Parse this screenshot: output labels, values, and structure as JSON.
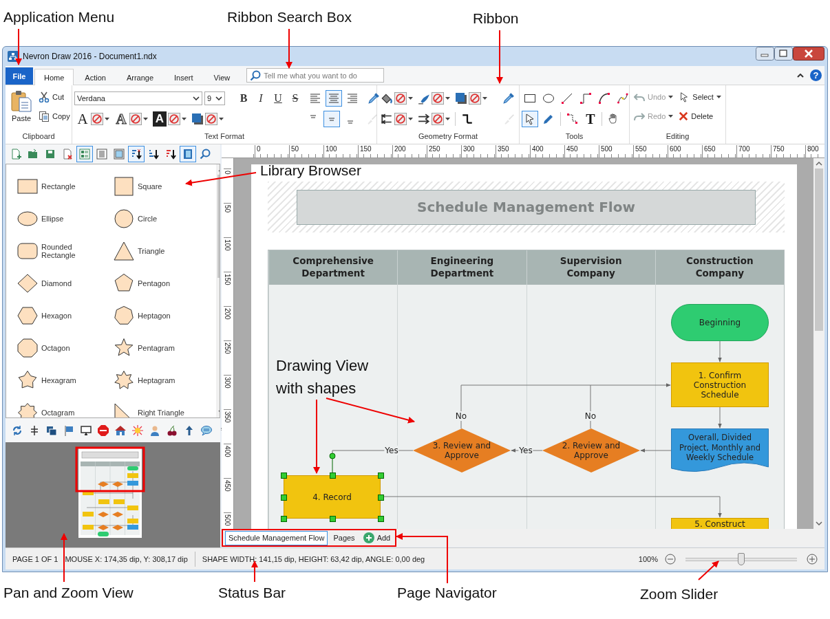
{
  "annotations": [
    {
      "text": "Application Menu"
    },
    {
      "text": "Ribbon Search Box"
    },
    {
      "text": "Ribbon"
    },
    {
      "text": "Library Browser"
    },
    {
      "text": "Drawing View with shapes"
    },
    {
      "text": "Pan and Zoom View"
    },
    {
      "text": "Status Bar"
    },
    {
      "text": "Page Navigator"
    },
    {
      "text": "Zoom Slider"
    }
  ],
  "window": {
    "title": "Nevron Draw 2016 - Document1.ndx"
  },
  "ribbon_tabs": {
    "file": "File",
    "tabs": [
      {
        "label": "Home",
        "selected": true
      },
      {
        "label": "Action",
        "selected": false
      },
      {
        "label": "Arrange",
        "selected": false
      },
      {
        "label": "Insert",
        "selected": false
      },
      {
        "label": "View",
        "selected": false
      }
    ],
    "search": {
      "placeholder": "Tell me what you want to do"
    },
    "help": "?"
  },
  "ribbon": {
    "clipboard": {
      "label": "Clipboard",
      "paste": "Paste",
      "cut": "Cut",
      "copy": "Copy"
    },
    "text_format": {
      "label": "Text Format",
      "font": "Verdana",
      "size": "9",
      "style_buttons": [
        {
          "glyph": "B",
          "kind": "bold"
        },
        {
          "glyph": "I",
          "kind": "italic"
        },
        {
          "glyph": "U",
          "kind": "underline"
        },
        {
          "glyph": "S",
          "kind": "strikethrough"
        }
      ],
      "horizontal_align": [
        {
          "selected": false
        },
        {
          "selected": true
        },
        {
          "selected": false
        }
      ],
      "color_buttons": [
        {
          "glyph": "A",
          "kind": "font_color"
        },
        {
          "glyph": "A",
          "kind": "outline"
        },
        {
          "glyph": "A",
          "kind": "highlight"
        }
      ],
      "vertical_align": [
        {
          "selected": false
        },
        {
          "selected": true
        },
        {
          "selected": false
        }
      ],
      "format_painter": {
        "disabled": true
      }
    },
    "geometry_format": {
      "label": "Geometry Format",
      "format_painter": {
        "disabled": true
      }
    },
    "tools": {
      "label": "Tools",
      "text_tool": "T",
      "pointer_tool": {
        "selected": true
      },
      "pen_tool": {
        "selected": false
      }
    },
    "editing": {
      "label": "Editing",
      "undo": {
        "label": "Undo",
        "disabled": true
      },
      "redo": {
        "label": "Redo",
        "disabled": true
      },
      "select": {
        "label": "Select"
      },
      "delete": {
        "label": "Delete"
      }
    }
  },
  "library": {
    "toolbar": {
      "view_modes": [
        {
          "selected": true
        },
        {
          "selected": false
        },
        {
          "selected": false
        }
      ],
      "sort_modes": [
        {
          "selected": true
        },
        {
          "selected": false
        },
        {
          "selected": false
        }
      ],
      "book": {
        "selected": true
      }
    },
    "items": [
      {
        "label": "Rectangle",
        "kind": "rectangle"
      },
      {
        "label": "Square",
        "kind": "square"
      },
      {
        "label": "Ellipse",
        "kind": "ellipse"
      },
      {
        "label": "Circle",
        "kind": "circle"
      },
      {
        "label": "Rounded Rectangle",
        "kind": "rounded_rectangle"
      },
      {
        "label": "Triangle",
        "kind": "triangle"
      },
      {
        "label": "Diamond",
        "kind": "diamond"
      },
      {
        "label": "Pentagon",
        "kind": "pentagon"
      },
      {
        "label": "Hexagon",
        "kind": "hexagon"
      },
      {
        "label": "Heptagon",
        "kind": "heptagon"
      },
      {
        "label": "Octagon",
        "kind": "octagon"
      },
      {
        "label": "Pentagram",
        "kind": "pentagram"
      },
      {
        "label": "Hexagram",
        "kind": "hexagram"
      },
      {
        "label": "Heptagram",
        "kind": "heptagram"
      },
      {
        "label": "Octagram",
        "kind": "octagram"
      },
      {
        "label": "Right Triangle",
        "kind": "right_triangle"
      }
    ]
  },
  "rulers": {
    "horizontal": [
      "0",
      "50",
      "100",
      "150",
      "200",
      "250",
      "300",
      "350",
      "400",
      "450",
      "500",
      "550",
      "600",
      "650",
      "700",
      "750",
      "800"
    ],
    "vertical": [
      "0",
      "50",
      "100",
      "150",
      "200",
      "250",
      "300",
      "350",
      "400",
      "450",
      "500"
    ]
  },
  "diagram": {
    "title": "Schedule Management Flow",
    "lanes": [
      "Comprehensive Department",
      "Engineering Department",
      "Supervision Company",
      "Construction Company"
    ],
    "nodes": [
      {
        "kind": "terminator",
        "text": "Beginning",
        "color": "#2ecc71",
        "selected": false
      },
      {
        "kind": "process",
        "text": "1. Confirm Construction Schedule",
        "color": "#f1c40f",
        "selected": false
      },
      {
        "kind": "decision",
        "text": "3. Review and Approve",
        "color": "#e67e22",
        "selected": false
      },
      {
        "kind": "decision",
        "text": "2. Review and Approve",
        "color": "#e67e22",
        "selected": false
      },
      {
        "kind": "document",
        "text": "Overall, Divided Project, Monthly and Weekly Schedule",
        "color": "#3498db",
        "selected": false
      },
      {
        "kind": "process",
        "text": "4. Record",
        "color": "#f1c40f",
        "selected": true
      },
      {
        "kind": "process",
        "text": "5. Construct",
        "color": "#f1c40f",
        "selected": false
      }
    ],
    "connector_labels": [
      "No",
      "No",
      "Yes",
      "Yes"
    ]
  },
  "page_navigator": {
    "pages": [
      {
        "label": "Schedule Management Flow",
        "selected": true
      }
    ],
    "pages_button": "Pages",
    "add_button": "Add"
  },
  "status_bar": {
    "page": "PAGE 1 OF 1",
    "mouse": "MOUSE X: 174,35 dip, Y: 308,17 dip",
    "shape": "SHAPE WIDTH: 141,15 dip, HEIGHT: 63,42 dip, ANGLE: 0,00 deg",
    "zoom": "100%",
    "zoom_slider": {
      "level": 0.5
    }
  }
}
